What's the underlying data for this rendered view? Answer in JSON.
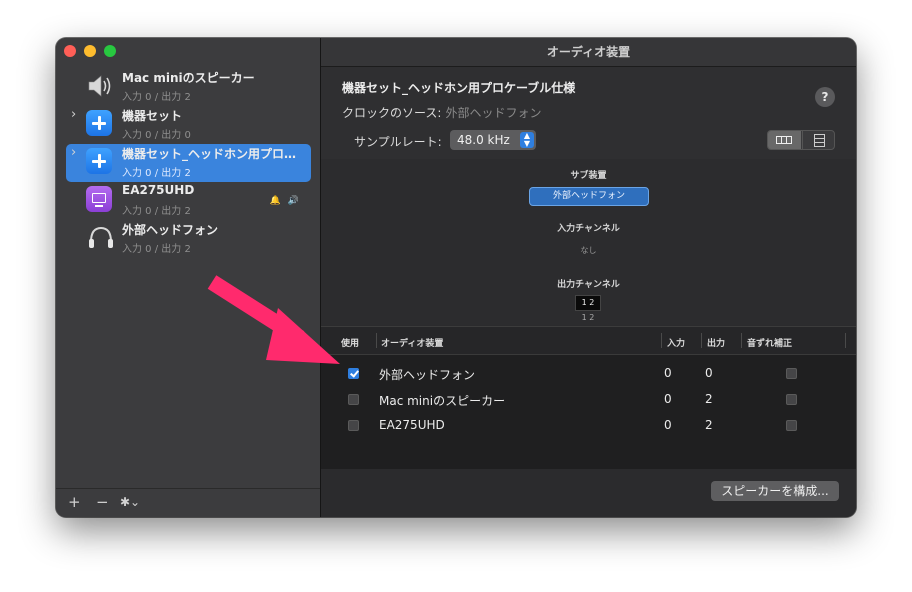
{
  "window": {
    "title": "オーディオ装置"
  },
  "sidebar": {
    "devices": [
      {
        "name": "Mac miniのスピーカー",
        "io": "入力 0 / 出力 2",
        "expandable": false,
        "selected": false,
        "icon": "speaker-icon"
      },
      {
        "name": "機器セット",
        "io": "入力 0 / 出力 0",
        "expandable": true,
        "selected": false,
        "icon": "aggregate-device-icon"
      },
      {
        "name": "機器セット_ヘッドホン用プロ…",
        "io": "入力 0 / 出力 2",
        "expandable": true,
        "selected": true,
        "icon": "aggregate-device-icon"
      },
      {
        "name": "EA275UHD",
        "io": "入力 0 / 出力 2",
        "expandable": false,
        "selected": false,
        "icon": "display-icon",
        "status": "🔔 🔊"
      },
      {
        "name": "外部ヘッドフォン",
        "io": "入力 0 / 出力 2",
        "expandable": false,
        "selected": false,
        "icon": "headphones-icon"
      }
    ],
    "footer": {
      "add": "+",
      "remove": "−",
      "gear": "✱⌄"
    }
  },
  "detail": {
    "device_title": "機器セット_ヘッドホン用プロケーブル仕様",
    "clock_label": "クロックのソース:",
    "clock_value": "外部ヘッドフォン",
    "help": "?",
    "sample_rate_label": "サンプルレート:",
    "sample_rate_value": "48.0 kHz"
  },
  "graph": {
    "subdevice_label": "サブ装置",
    "subdevice_name": "外部ヘッドフォン",
    "input_label": "入力チャンネル",
    "input_value": "なし",
    "output_label": "出力チャンネル",
    "output_channels": "1 2",
    "output_channels_sub": "1 2"
  },
  "table": {
    "headers": {
      "use": "使用",
      "device": "オーディオ装置",
      "in": "入力",
      "out": "出力",
      "drift": "音ずれ補正"
    },
    "rows": [
      {
        "use": true,
        "device": "外部ヘッドフォン",
        "in": "0",
        "out": "0",
        "drift": false
      },
      {
        "use": false,
        "device": "Mac miniのスピーカー",
        "in": "0",
        "out": "2",
        "drift": false
      },
      {
        "use": false,
        "device": "EA275UHD",
        "in": "0",
        "out": "2",
        "drift": false
      }
    ]
  },
  "footer": {
    "configure_button": "スピーカーを構成..."
  },
  "colors": {
    "accent": "#3a84dd",
    "annotation_arrow": "#ff2a6d"
  }
}
